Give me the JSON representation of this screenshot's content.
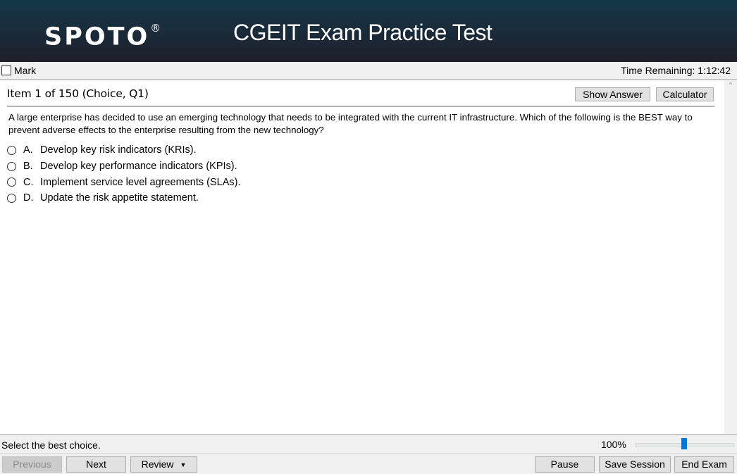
{
  "header": {
    "logo": "SPOTO",
    "logo_mark": "®",
    "title": "CGEIT Exam Practice Test"
  },
  "markbar": {
    "mark_label": "Mark",
    "mark_checked": false,
    "time_remaining": "Time Remaining: 1:12:42"
  },
  "item": {
    "title": "Item 1 of 150 (Choice, Q1)",
    "show_answer_label": "Show Answer",
    "calculator_label": "Calculator",
    "question": "A large enterprise has decided to use an emerging technology that needs to be integrated with the current IT infrastructure. Which of the following is the BEST way to prevent adverse effects to the enterprise resulting from the new technology?",
    "options": [
      {
        "letter": "A.",
        "text": "Develop key risk indicators (KRIs).",
        "selected": false
      },
      {
        "letter": "B.",
        "text": "Develop key performance indicators (KPIs).",
        "selected": false
      },
      {
        "letter": "C.",
        "text": "Implement service level agreements (SLAs).",
        "selected": false
      },
      {
        "letter": "D.",
        "text": "Update the risk appetite statement.",
        "selected": false
      }
    ]
  },
  "scrollbar": {
    "up_icon": "chevron-up-icon"
  },
  "status": {
    "instruction": "Select the best choice.",
    "zoom_label": "100%",
    "zoom_slider_position": 0.5
  },
  "nav": {
    "previous_label": "Previous",
    "previous_enabled": false,
    "next_label": "Next",
    "review_label": "Review",
    "pause_label": "Pause",
    "save_session_label": "Save Session",
    "end_exam_label": "End Exam"
  },
  "colors": {
    "header_top": "#133849",
    "header_bottom": "#1e1f2b",
    "slider_thumb": "#0078d7",
    "button_bg": "#e1e1e1"
  }
}
